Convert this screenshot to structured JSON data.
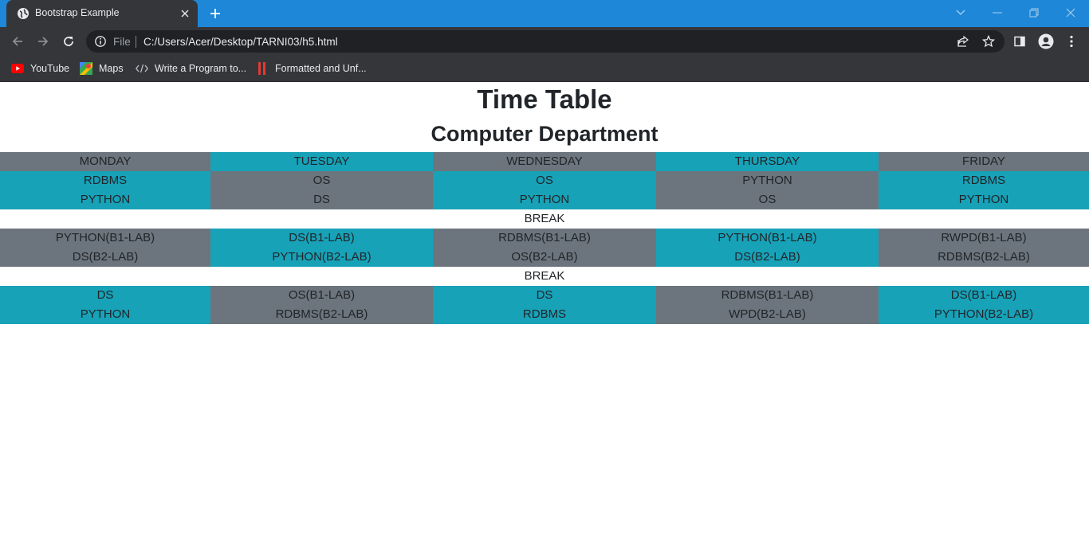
{
  "browser": {
    "tab_title": "Bootstrap Example",
    "address_scheme": "File",
    "address_url": "C:/Users/Acer/Desktop/TARNI03/h5.html",
    "bookmarks": [
      {
        "label": "YouTube",
        "icon": "youtube-icon"
      },
      {
        "label": "Maps",
        "icon": "maps-icon"
      },
      {
        "label": "Write a Program to...",
        "icon": "code-icon"
      },
      {
        "label": "Formatted and Unf...",
        "icon": "bookmark-red-icon"
      }
    ],
    "colors": {
      "titlebar": "#1f87d8",
      "toolbar": "#35363a",
      "omnibox": "#202124"
    }
  },
  "page": {
    "title": "Time Table",
    "subtitle": "Computer Department",
    "colors": {
      "gray": "#6c757d",
      "teal": "#17a2b8"
    },
    "days": [
      "MONDAY",
      "TUESDAY",
      "WEDNESDAY",
      "THURSDAY",
      "FRIDAY"
    ],
    "block1": {
      "row1": [
        "RDBMS",
        "OS",
        "OS",
        "PYTHON",
        "RDBMS"
      ],
      "row2": [
        "PYTHON",
        "DS",
        "PYTHON",
        "OS",
        "PYTHON"
      ]
    },
    "break1": "BREAK",
    "block2": {
      "row1": [
        "PYTHON(B1-LAB)",
        "DS(B1-LAB)",
        "RDBMS(B1-LAB)",
        "PYTHON(B1-LAB)",
        "RWPD(B1-LAB)"
      ],
      "row2": [
        "DS(B2-LAB)",
        "PYTHON(B2-LAB)",
        "OS(B2-LAB)",
        "DS(B2-LAB)",
        "RDBMS(B2-LAB)"
      ]
    },
    "break2": "BREAK",
    "block3": {
      "row1": [
        "DS",
        "OS(B1-LAB)",
        "DS",
        "RDBMS(B1-LAB)",
        "DS(B1-LAB)"
      ],
      "row2": [
        "PYTHON",
        "RDBMS(B2-LAB)",
        "RDBMS",
        "WPD(B2-LAB)",
        "PYTHON(B2-LAB)"
      ]
    }
  }
}
